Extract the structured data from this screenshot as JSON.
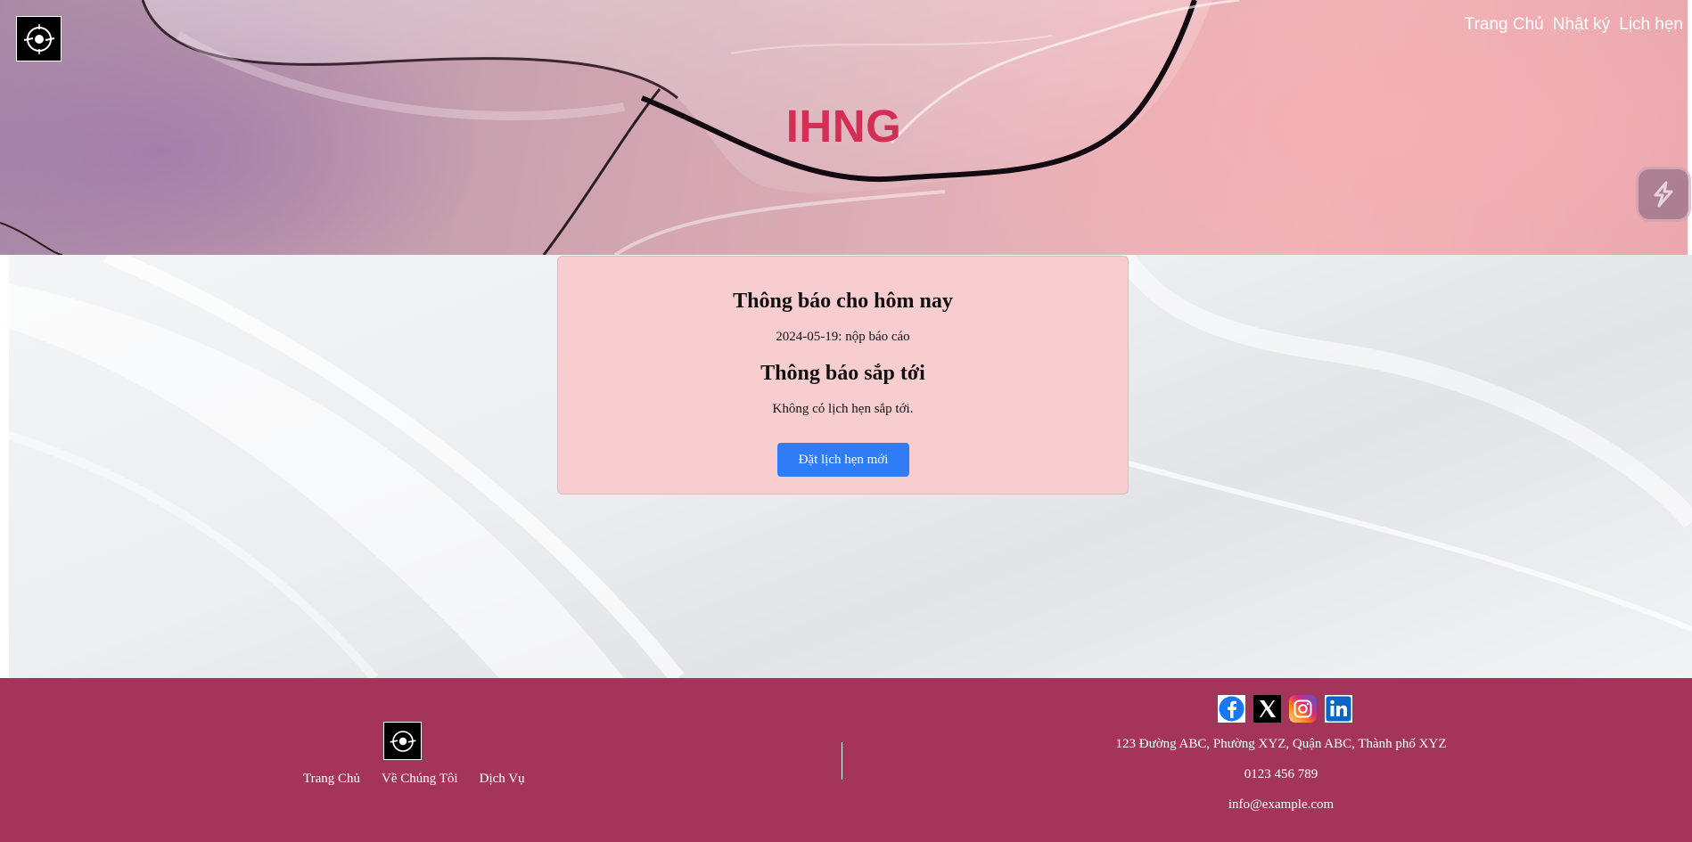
{
  "header": {
    "brand": "IHNG",
    "nav": [
      "Trang Chủ",
      "Nhật ký",
      "Lịch hẹn"
    ],
    "logo_icon": "compass-logo-icon",
    "widget_icon": "lightning-widget-icon"
  },
  "notices": {
    "today_title": "Thông báo cho hôm nay",
    "today_item": "2024-05-19: nộp báo cáo",
    "upcoming_title": "Thông báo sắp tới",
    "upcoming_text": "Không có lịch hẹn sắp tới.",
    "book_button": "Đặt lịch hẹn mới"
  },
  "footer": {
    "links": [
      "Trang Chủ",
      "Về Chúng Tôi",
      "Dịch Vụ"
    ],
    "social": [
      "facebook-icon",
      "x-icon",
      "instagram-icon",
      "linkedin-icon"
    ],
    "address": "123 Đường ABC, Phường XYZ, Quận ABC, Thành phố XYZ",
    "phone": "0123 456 789",
    "email": "info@example.com"
  },
  "colors": {
    "brand": "#d42d56",
    "footer_bg": "#a5345b",
    "card_bg": "#f7cdd0",
    "button": "#2f7cf6"
  }
}
